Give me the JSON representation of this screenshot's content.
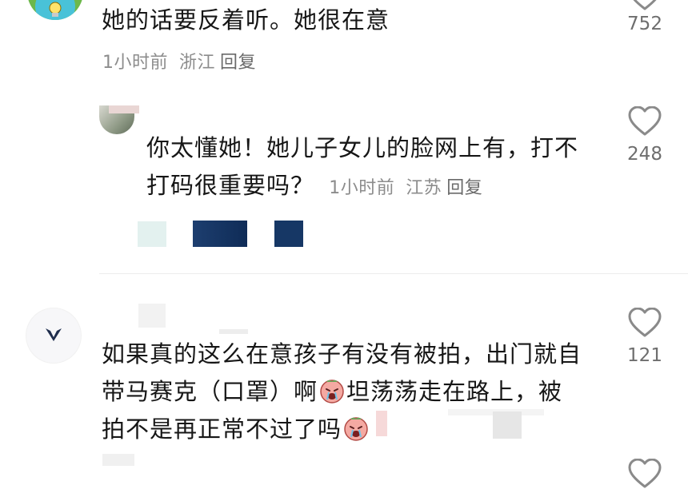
{
  "comments": [
    {
      "text": "她的话要反着听。她很在意",
      "time": "1小时前",
      "location": "浙江",
      "reply_label": "回复",
      "likes": "752"
    },
    {
      "line1": "你太懂她！她儿子女儿的脸网上有，打不",
      "line2": "打码很重要吗？",
      "time": "1小时前",
      "location": "江苏",
      "reply_label": "回复",
      "likes": "248"
    },
    {
      "line1": "如果真的这么在意孩子有没有被拍，出门就自",
      "line2a": "带马赛克（口罩）啊",
      "line2b": "坦荡荡走在路上，被",
      "line3": "拍不是再正常不过了吗",
      "likes": "121"
    }
  ],
  "colors": {
    "text": "#161616",
    "meta": "#8c8c8c",
    "count": "#6e6e6e",
    "heart_outline": "#8a8a8a",
    "divider": "#ececec"
  },
  "icons": {
    "like": "heart-outline-icon",
    "emoji": "crying-face-emoji-icon",
    "avatar_badge": "lightbulb-icon"
  }
}
